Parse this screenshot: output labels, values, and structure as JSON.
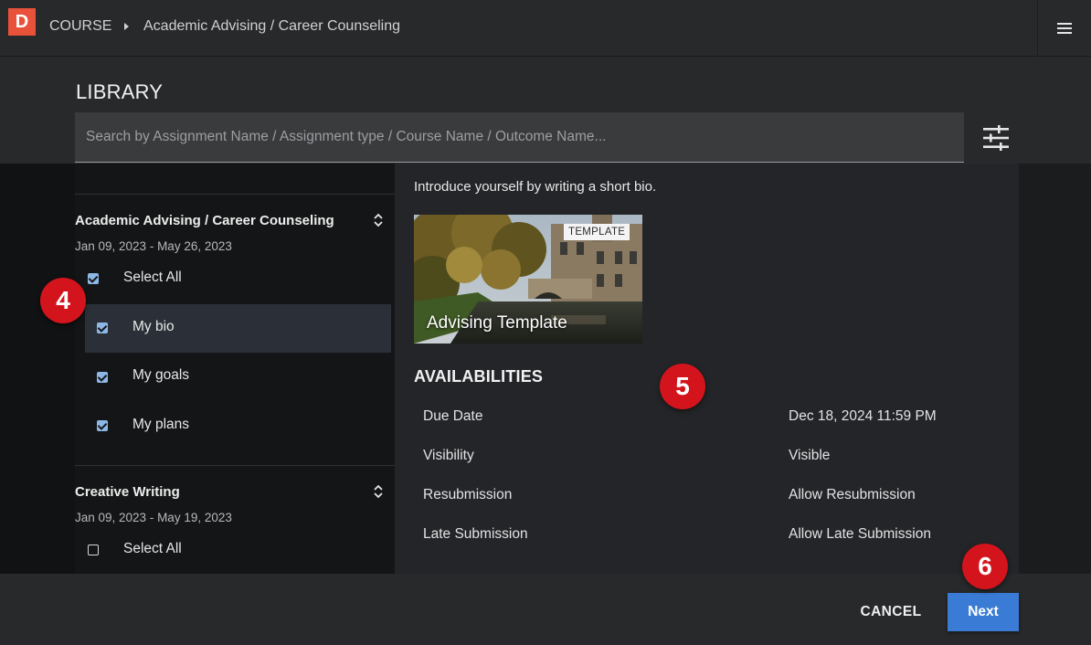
{
  "header": {
    "logo_letter": "D",
    "breadcrumb_root": "COURSE",
    "breadcrumb_leaf": "Academic Advising / Career Counseling"
  },
  "library": {
    "title": "LIBRARY",
    "search_placeholder": "Search by Assignment Name / Assignment type / Course Name / Outcome Name..."
  },
  "courses": [
    {
      "title": "Academic Advising / Career Counseling",
      "dates": "Jan 09, 2023 - May 26, 2023",
      "select_all": "Select All",
      "select_all_checked": true,
      "items": [
        {
          "label": "My bio",
          "checked": true,
          "selected": true
        },
        {
          "label": "My goals",
          "checked": true,
          "selected": false
        },
        {
          "label": "My plans",
          "checked": true,
          "selected": false
        }
      ]
    },
    {
      "title": "Creative Writing",
      "dates": "Jan 09, 2023 - May 19, 2023",
      "select_all": "Select All",
      "select_all_checked": false
    }
  ],
  "detail": {
    "description": "Introduce yourself by writing a short bio.",
    "template_badge": "TEMPLATE",
    "template_title": "Advising Template",
    "availabilities_title": "AVAILABILITIES",
    "availabilities": [
      {
        "label": "Due Date",
        "value": "Dec 18, 2024 11:59 PM"
      },
      {
        "label": "Visibility",
        "value": "Visible"
      },
      {
        "label": "Resubmission",
        "value": "Allow Resubmission"
      },
      {
        "label": "Late Submission",
        "value": "Allow Late Submission"
      }
    ]
  },
  "footer": {
    "cancel_label": "CANCEL",
    "next_label": "Next"
  },
  "markers": [
    "4",
    "5",
    "6"
  ],
  "colors": {
    "accent": "#3a7bd5",
    "logo": "#e8523a",
    "marker": "#d4141c",
    "checkbox": "#8db8e6"
  }
}
